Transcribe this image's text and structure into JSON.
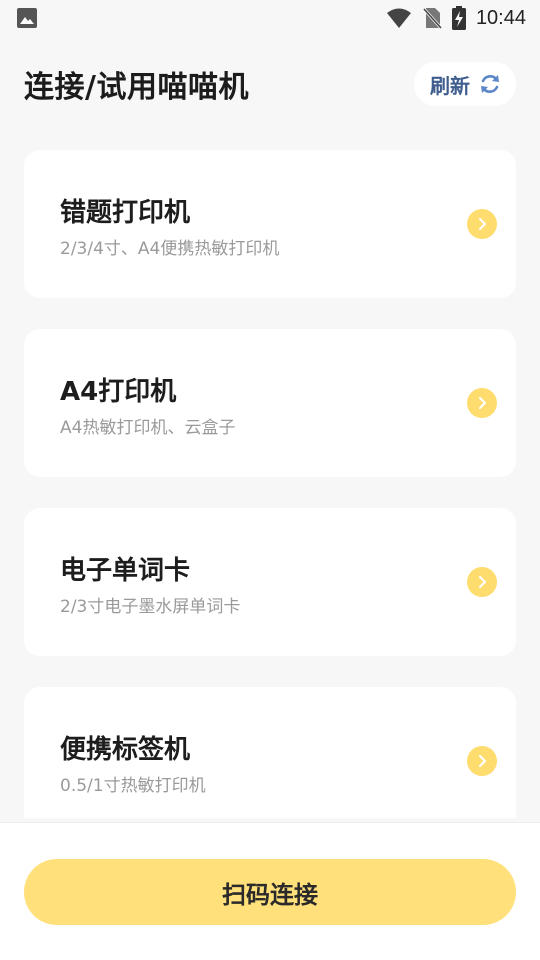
{
  "status_bar": {
    "time": "10:44",
    "icons": [
      "image-icon",
      "wifi-icon",
      "no-sim-icon",
      "battery-charging-icon"
    ]
  },
  "header": {
    "title": "连接/试用喵喵机",
    "refresh_label": "刷新"
  },
  "devices": [
    {
      "title": "错题打印机",
      "desc": "2/3/4寸、A4便携热敏打印机"
    },
    {
      "title": "A4打印机",
      "desc": "A4热敏打印机、云盒子"
    },
    {
      "title": "电子单词卡",
      "desc": "2/3寸电子墨水屏单词卡"
    },
    {
      "title": "便携标签机",
      "desc": "0.5/1寸热敏打印机"
    }
  ],
  "bottom": {
    "scan_label": "扫码连接"
  },
  "colors": {
    "accent": "#ffe07a",
    "chevron": "#ffdc6e",
    "refresh_text": "#3f5d8f",
    "background": "#f7f7f7"
  }
}
